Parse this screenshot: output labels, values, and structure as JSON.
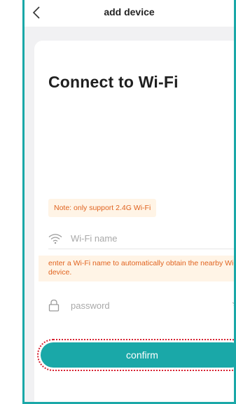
{
  "header": {
    "title": "add device"
  },
  "main": {
    "heading": "Connect to Wi-Fi",
    "note": "Note: only support 2.4G Wi-Fi",
    "wifi_placeholder": "Wi-Fi name",
    "hint": "enter a Wi-Fi name to automatically obtain the nearby Wi-Fi device.",
    "password_placeholder": "password",
    "confirm_label": "confirm"
  },
  "colors": {
    "accent": "#1aa8a8",
    "warning_text": "#e0631f",
    "warning_bg": "#fff4e6",
    "highlight": "#d62030"
  }
}
